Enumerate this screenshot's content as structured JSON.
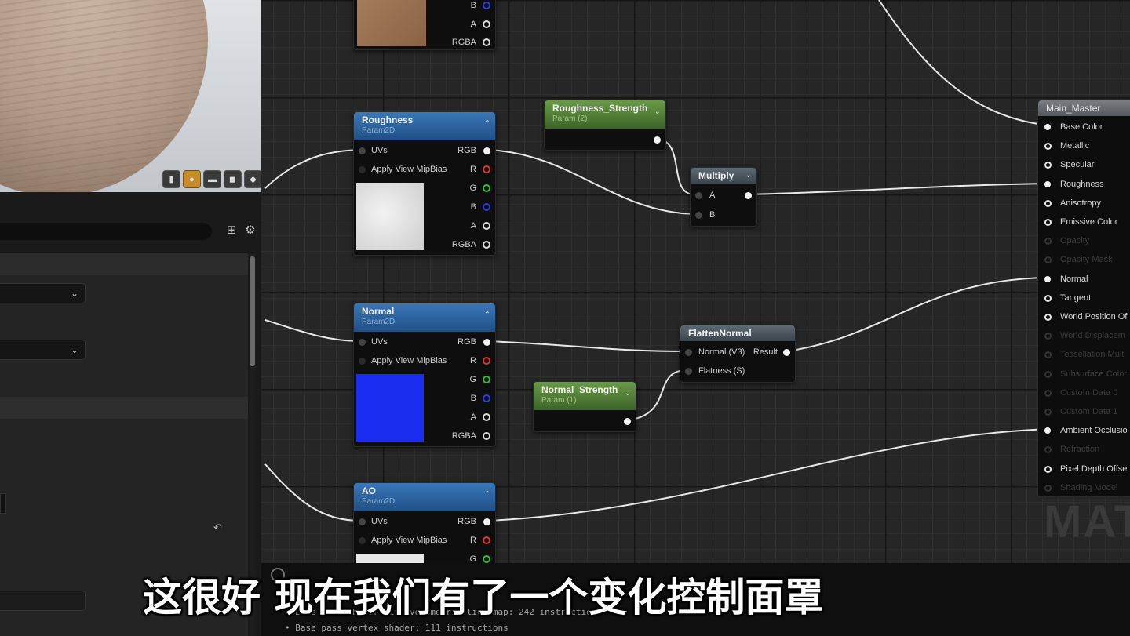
{
  "viewport": {
    "buttons": [
      "cylinder-icon",
      "sphere-icon",
      "plane-icon",
      "cube-icon",
      "teapot-icon"
    ]
  },
  "nodes": {
    "top_partial": {
      "pins": [
        "B",
        "A",
        "RGBA"
      ]
    },
    "roughness": {
      "title": "Roughness",
      "subtitle": "Param2D",
      "inputs": [
        "UVs",
        "Apply View MipBias"
      ],
      "outputs": [
        "RGB",
        "R",
        "G",
        "B",
        "A",
        "RGBA"
      ]
    },
    "roughness_strength": {
      "title": "Roughness_Strength",
      "subtitle": "Param (2)"
    },
    "multiply": {
      "title": "Multiply",
      "inputs": [
        "A",
        "B"
      ]
    },
    "normal": {
      "title": "Normal",
      "subtitle": "Param2D",
      "inputs": [
        "UVs",
        "Apply View MipBias"
      ],
      "outputs": [
        "RGB",
        "R",
        "G",
        "B",
        "A",
        "RGBA"
      ]
    },
    "flatten_normal": {
      "title": "FlattenNormal",
      "inputs": [
        "Normal (V3)",
        "Flatness (S)"
      ],
      "output": "Result"
    },
    "normal_strength": {
      "title": "Normal_Strength",
      "subtitle": "Param (1)"
    },
    "ao": {
      "title": "AO",
      "subtitle": "Param2D",
      "inputs": [
        "UVs",
        "Apply View MipBias"
      ],
      "outputs": [
        "RGB",
        "R",
        "G"
      ]
    }
  },
  "master": {
    "title": "Main_Master",
    "pins": [
      {
        "label": "Base Color",
        "state": "on"
      },
      {
        "label": "Metallic",
        "state": "ring"
      },
      {
        "label": "Specular",
        "state": "ring"
      },
      {
        "label": "Roughness",
        "state": "on"
      },
      {
        "label": "Anisotropy",
        "state": "ring"
      },
      {
        "label": "Emissive Color",
        "state": "ring"
      },
      {
        "label": "Opacity",
        "state": "off"
      },
      {
        "label": "Opacity Mask",
        "state": "off"
      },
      {
        "label": "Normal",
        "state": "on"
      },
      {
        "label": "Tangent",
        "state": "ring"
      },
      {
        "label": "World Position Of",
        "state": "ring"
      },
      {
        "label": "World Displacem",
        "state": "off"
      },
      {
        "label": "Tessellation Mult",
        "state": "off"
      },
      {
        "label": "Subsurface Color",
        "state": "off"
      },
      {
        "label": "Custom Data 0",
        "state": "off"
      },
      {
        "label": "Custom Data 1",
        "state": "off"
      },
      {
        "label": "Ambient Occlusio",
        "state": "on"
      },
      {
        "label": "Refraction",
        "state": "off"
      },
      {
        "label": "Pixel Depth Offse",
        "state": "ring"
      },
      {
        "label": "Shading Model",
        "state": "off"
      }
    ],
    "watermark": "MAT"
  },
  "stats": {
    "lines": [
      "• Base pass shader with volumetric lightmap: 242 instructions",
      "• Base pass vertex shader: 111 instructions"
    ]
  },
  "subtitle": "这很好 现在我们有了一个变化控制面罩",
  "colors": {
    "param_blue": "#2a66a8",
    "scalar_green": "#5a8a3c",
    "pin_red": "#e23333",
    "pin_green": "#30c230",
    "pin_blue": "#2a3de8"
  }
}
